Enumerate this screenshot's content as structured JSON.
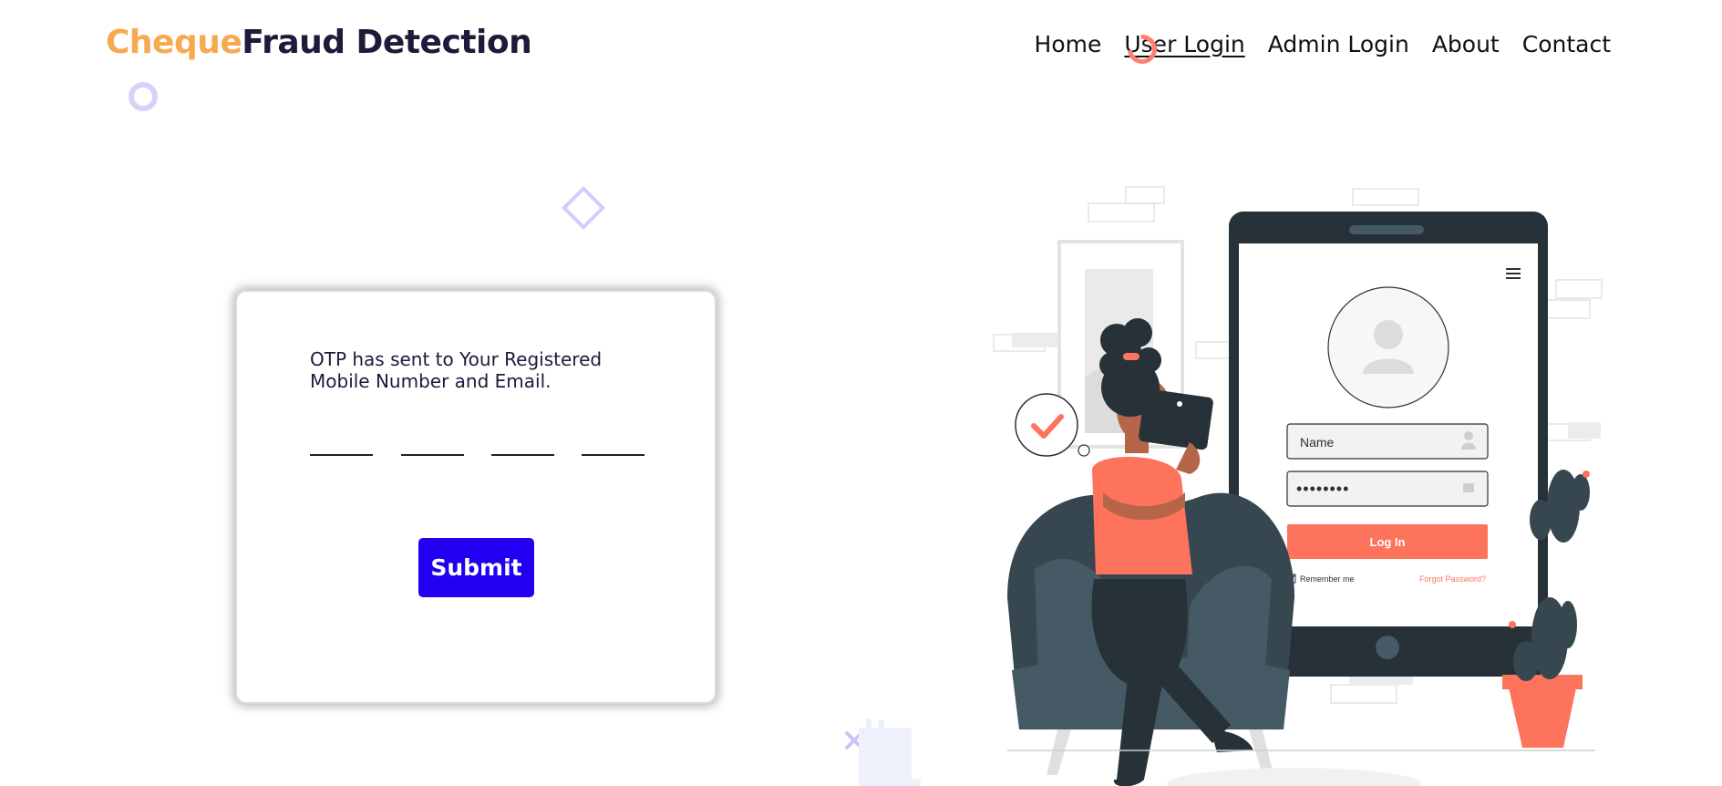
{
  "brand": {
    "part1": "Cheque",
    "part2": "Fraud Detection"
  },
  "nav": [
    {
      "label": "Home"
    },
    {
      "label": "User Login"
    },
    {
      "label": "Admin Login"
    },
    {
      "label": "About"
    },
    {
      "label": "Contact"
    }
  ],
  "otp_card": {
    "message": "OTP has sent to Your Registered Mobile Number and Email.",
    "digit_values": [
      "",
      "",
      "",
      ""
    ],
    "submit_label": "Submit"
  },
  "illustration": {
    "name_field": "Name",
    "password_field": "••••••••",
    "login_button": "Log In",
    "remember_label": "Remember me",
    "forgot_link": "Forgot Password?"
  },
  "colors": {
    "brand_orange": "#f7a94f",
    "brand_dark": "#1c1b3a",
    "submit_blue": "#2100f2",
    "illustration_accent": "#fd735b",
    "illustration_dark": "#263238"
  }
}
